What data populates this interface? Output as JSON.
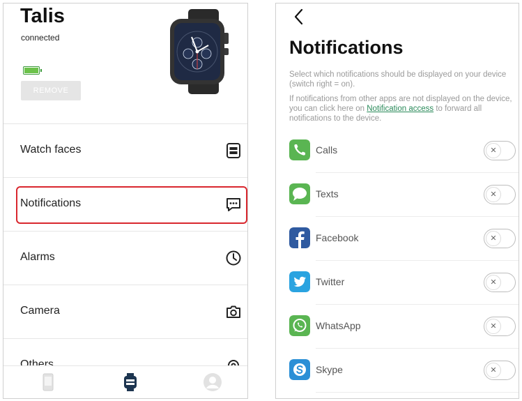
{
  "left": {
    "device_name": "Talis",
    "status": "connected",
    "remove_label": "REMOVE",
    "menu": [
      {
        "label": "Watch faces",
        "icon": "watch-face-icon"
      },
      {
        "label": "Notifications",
        "icon": "message-icon"
      },
      {
        "label": "Alarms",
        "icon": "clock-icon"
      },
      {
        "label": "Camera",
        "icon": "camera-icon"
      },
      {
        "label": "Others",
        "icon": "gear-icon"
      }
    ],
    "watch_display": {
      "top": "12",
      "bottom": "08"
    },
    "nav": [
      "phone-icon",
      "watch-icon",
      "profile-icon"
    ],
    "highlight_color": "#d9272e"
  },
  "right": {
    "title": "Notifications",
    "description1": "Select which notifications should be displayed on your device (switch right = on).",
    "description2_pre": "If notifications from other apps are not displayed on the device, you can click here on",
    "description2_link": "Notification access",
    "description2_post": "to forward all notifications to the device.",
    "apps": [
      {
        "name": "Calls",
        "icon": "phone-icon",
        "color": "#5ab552",
        "on": false
      },
      {
        "name": "Texts",
        "icon": "speech-bubble-icon",
        "color": "#5ab552",
        "on": false
      },
      {
        "name": "Facebook",
        "icon": "facebook-icon",
        "color": "#2f5aa0",
        "on": false
      },
      {
        "name": "Twitter",
        "icon": "twitter-icon",
        "color": "#2aa3e0",
        "on": false
      },
      {
        "name": "WhatsApp",
        "icon": "whatsapp-icon",
        "color": "#5ab552",
        "on": false
      },
      {
        "name": "Skype",
        "icon": "skype-icon",
        "color": "#2b8fd6",
        "on": false
      }
    ],
    "toggle_symbol": "✕",
    "link_color": "#2a8a5a"
  }
}
